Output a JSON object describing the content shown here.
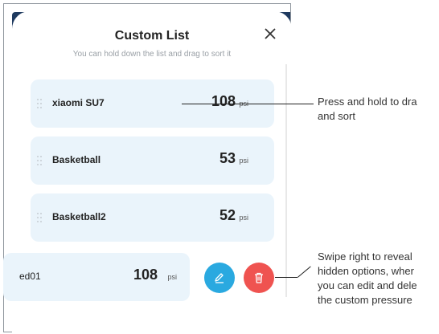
{
  "modal": {
    "title": "Custom List",
    "subtitle": "You can hold down the list and drag to sort it",
    "close_icon": "close-icon"
  },
  "items": [
    {
      "name": "xiaomi SU7",
      "value": "108",
      "unit": "psi"
    },
    {
      "name": "Basketball",
      "value": "53",
      "unit": "psi"
    },
    {
      "name": "Basketball2",
      "value": "52",
      "unit": "psi"
    },
    {
      "name": "ed01",
      "value": "108",
      "unit": "psi"
    }
  ],
  "actions": {
    "edit_icon": "edit-icon",
    "delete_icon": "trash-icon",
    "edit_color": "#2aa9e0",
    "delete_color": "#ef5350"
  },
  "annotations": {
    "drag_line1": "Press and hold to dra",
    "drag_line2": "and sort",
    "swipe_line1": "Swipe right to reveal",
    "swipe_line2": "hidden options, wher",
    "swipe_line3": "you can edit and dele",
    "swipe_line4": "the custom pressure"
  }
}
